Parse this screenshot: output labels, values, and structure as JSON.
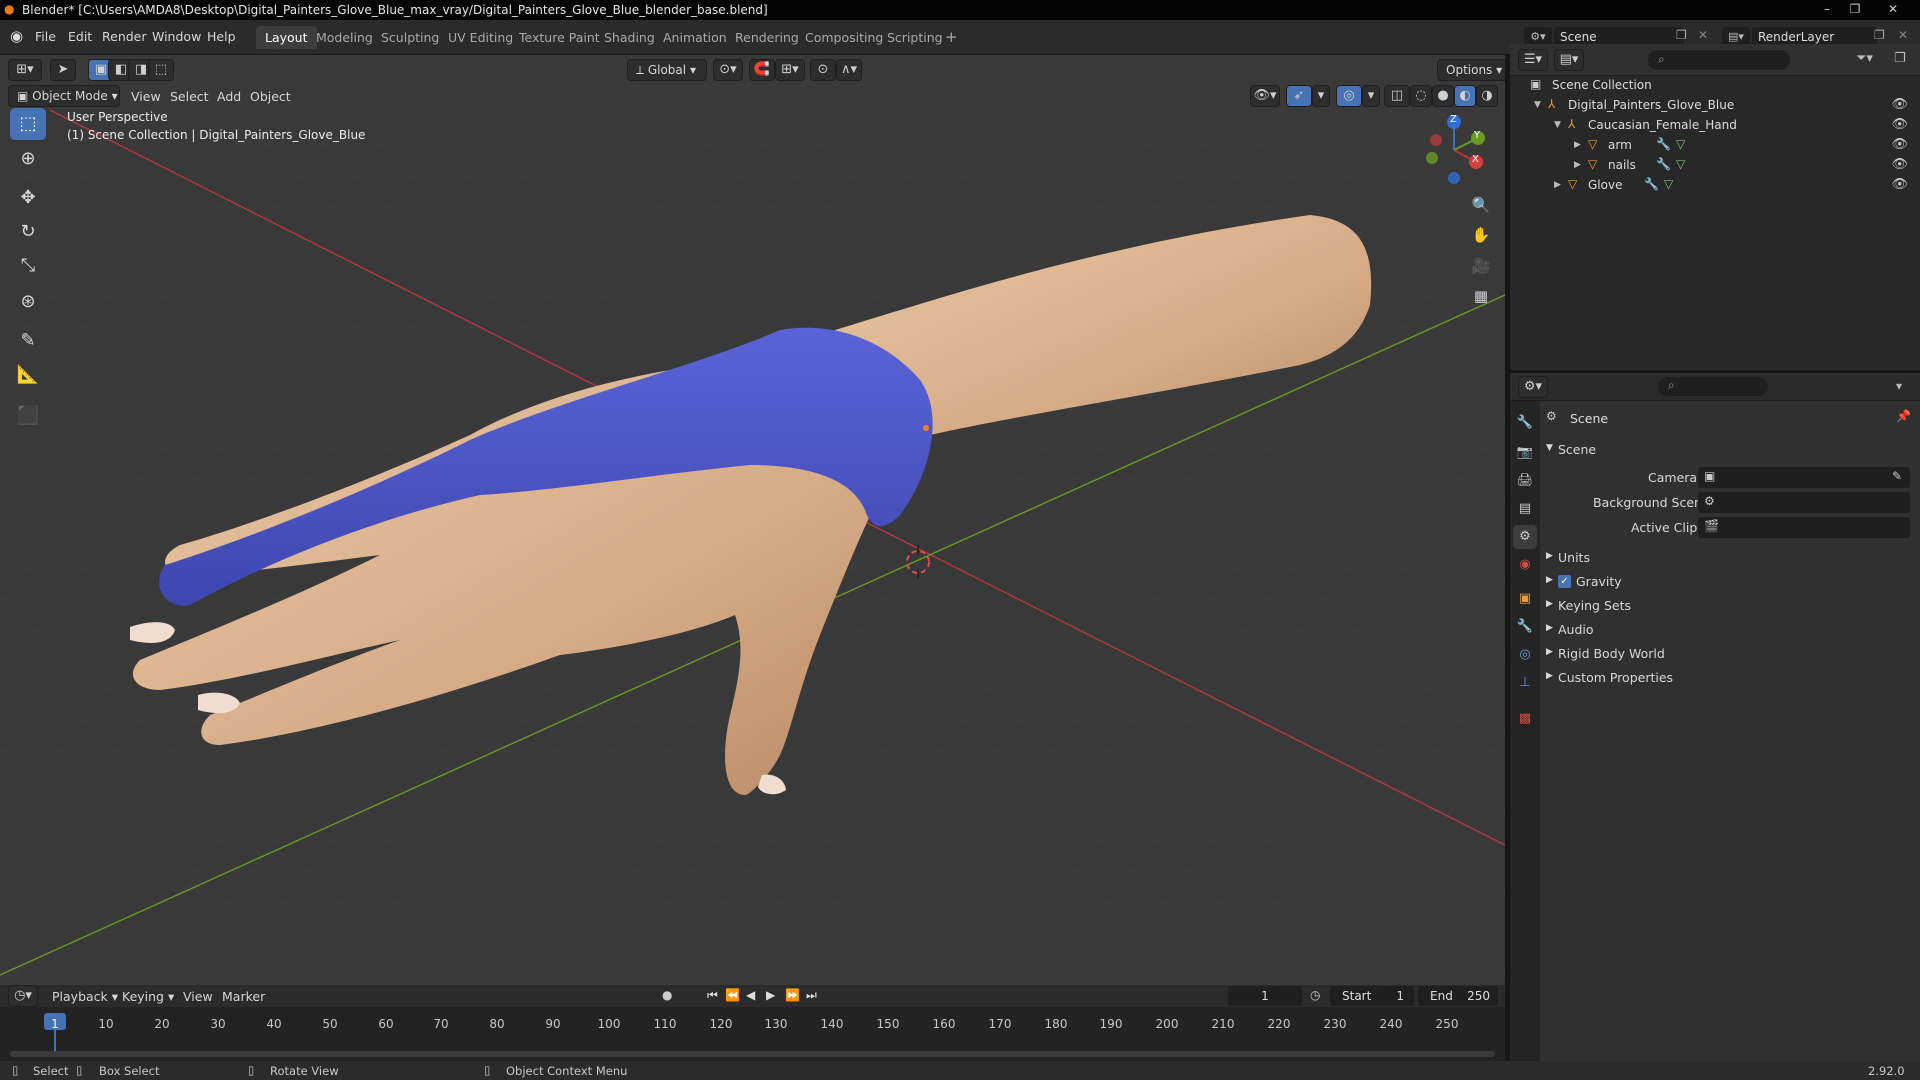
{
  "window": {
    "title": "Blender* [C:\\Users\\AMDA8\\Desktop\\Digital_Painters_Glove_Blue_max_vray/Digital_Painters_Glove_Blue_blender_base.blend]",
    "minimize": "–",
    "maximize": "❐",
    "close": "✕"
  },
  "menus": [
    "File",
    "Edit",
    "Render",
    "Window",
    "Help"
  ],
  "workspaces": [
    "Layout",
    "Modeling",
    "Sculpting",
    "UV Editing",
    "Texture Paint",
    "Shading",
    "Animation",
    "Rendering",
    "Compositing",
    "Scripting"
  ],
  "active_workspace": "Layout",
  "scene_selector": {
    "value": "Scene"
  },
  "view_layer_selector": {
    "value": "RenderLayer"
  },
  "viewport": {
    "mode": "Object Mode",
    "header_menus": [
      "View",
      "Select",
      "Add",
      "Object"
    ],
    "transform_orientation": "Global",
    "options_label": "Options",
    "overlay_title": "User Perspective",
    "overlay_subtitle": "(1) Scene Collection | Digital_Painters_Glove_Blue",
    "gizmo_labels": {
      "z": "Z",
      "y": "Y",
      "x": "X"
    }
  },
  "outliner": {
    "root": "Scene Collection",
    "items": [
      {
        "label": "Digital_Painters_Glove_Blue",
        "depth": 1
      },
      {
        "label": "Caucasian_Female_Hand",
        "depth": 2
      },
      {
        "label": "arm",
        "depth": 3
      },
      {
        "label": "nails",
        "depth": 3
      },
      {
        "label": "Glove",
        "depth": 2
      }
    ]
  },
  "properties": {
    "context": "Scene",
    "panel_title": "Scene",
    "fields": [
      {
        "label": "Camera"
      },
      {
        "label": "Background Scene"
      },
      {
        "label": "Active Clip"
      }
    ],
    "panels": [
      "Units",
      "Gravity",
      "Keying Sets",
      "Audio",
      "Rigid Body World",
      "Custom Properties"
    ]
  },
  "timeline": {
    "menus": [
      "Playback",
      "Keying",
      "View",
      "Marker"
    ],
    "current_frame": "1",
    "start_label": "Start",
    "start_value": "1",
    "end_label": "End",
    "end_value": "250",
    "ticks": [
      "1",
      "10",
      "20",
      "30",
      "40",
      "50",
      "60",
      "70",
      "80",
      "90",
      "100",
      "110",
      "120",
      "130",
      "140",
      "150",
      "160",
      "170",
      "180",
      "190",
      "200",
      "210",
      "220",
      "230",
      "240",
      "250"
    ]
  },
  "statusbar": {
    "select": "Select",
    "box_select": "Box Select",
    "rotate_view": "Rotate View",
    "context_menu": "Object Context Menu",
    "version": "2.92.0"
  },
  "colors": {
    "accent": "#4772b3",
    "glove": "#4f58c7",
    "skin": "#d8b08e",
    "axis_x": "#b4393c",
    "axis_y": "#6a9a23"
  }
}
